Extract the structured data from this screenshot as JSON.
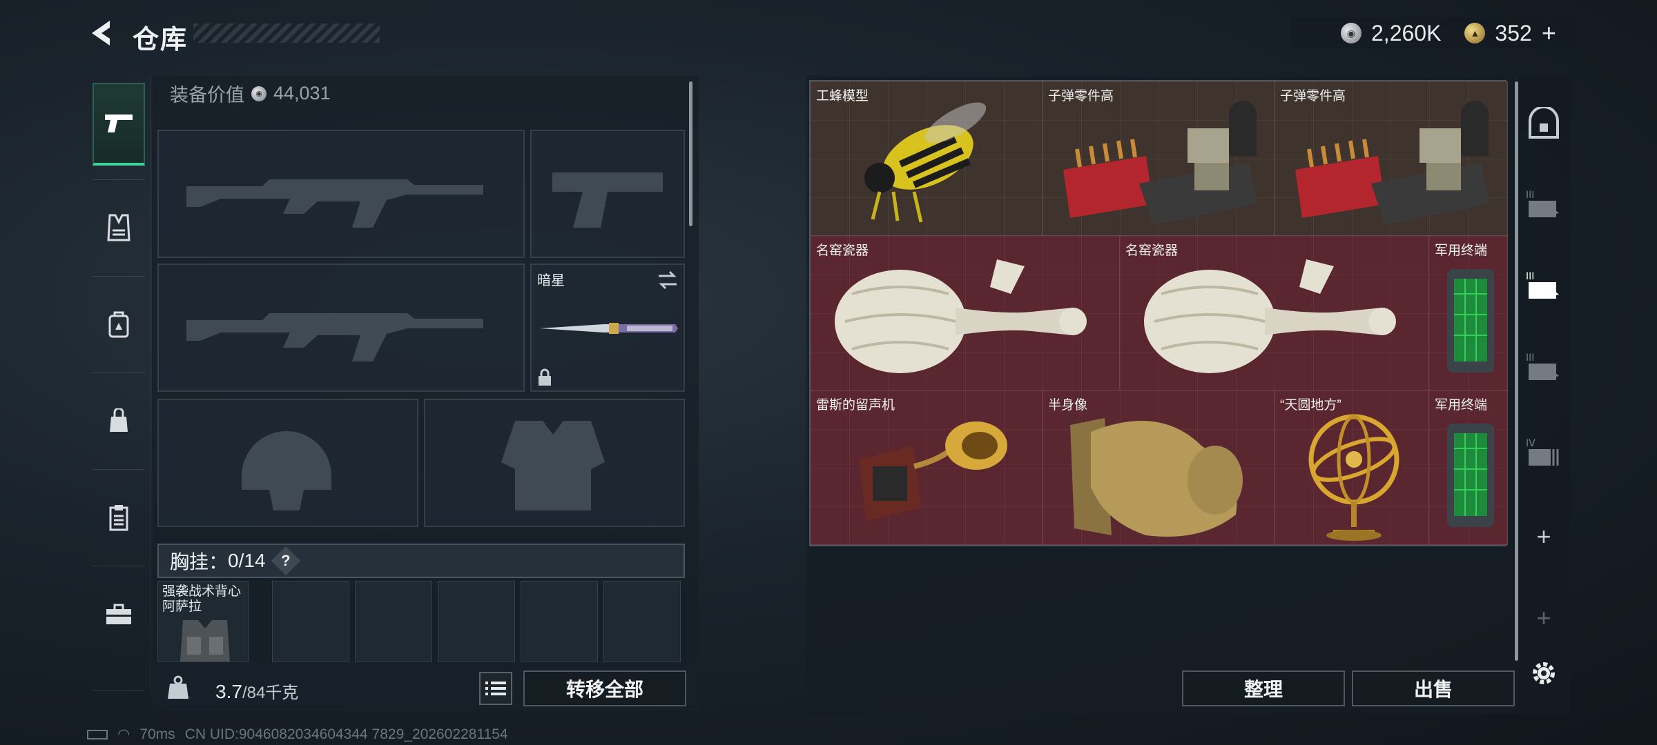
{
  "header": {
    "title": "仓库",
    "currency": [
      {
        "icon": "silver-coin-icon",
        "value": "2,260K"
      },
      {
        "icon": "gold-coin-icon",
        "value": "352"
      }
    ],
    "add_label": "+"
  },
  "left_rail": {
    "items": [
      {
        "name": "pistol-icon",
        "active": true
      },
      {
        "name": "vest-icon",
        "active": false
      },
      {
        "name": "backpack-icon",
        "active": false
      },
      {
        "name": "bag-icon",
        "active": false
      },
      {
        "name": "clipboard-icon",
        "active": false
      },
      {
        "name": "toolbox-icon",
        "active": false
      }
    ]
  },
  "equipment": {
    "value_label": "装备价值",
    "value": "44,031",
    "melee_slot_label": "暗星",
    "chest_rig_label": "胸挂：",
    "chest_rig_count": "0/14",
    "help_symbol": "?",
    "rig_item_name": "强袭战术背心\n阿萨拉",
    "weight": "3.7",
    "weight_capacity": "/84千克",
    "transfer_all": "转移全部"
  },
  "stash": {
    "items": [
      {
        "label": "工蜂模型",
        "color": "brown"
      },
      {
        "label": "子弹零件高",
        "color": "brown"
      },
      {
        "label": "子弹零件高",
        "color": "brown"
      },
      {
        "label": "名窑瓷器",
        "color": "red"
      },
      {
        "label": "名窑瓷器",
        "color": "red"
      },
      {
        "label": "军用终端",
        "color": "red"
      },
      {
        "label": "雷斯的留声机",
        "color": "red"
      },
      {
        "label": "半身像",
        "color": "red"
      },
      {
        "label": "“天圆地方”",
        "color": "red"
      },
      {
        "label": "军用终端",
        "color": "red"
      }
    ],
    "sort_button": "整理",
    "sell_button": "出售"
  },
  "right_rail": {
    "add1": "+",
    "add2": "+"
  },
  "status": {
    "ping": "70ms",
    "uid": "CN UID:9046082034604344 7829_202602281154"
  },
  "colors": {
    "accent_green": "#3fd39b",
    "cell_brown": "#3f342d",
    "cell_red": "#5a2630"
  }
}
